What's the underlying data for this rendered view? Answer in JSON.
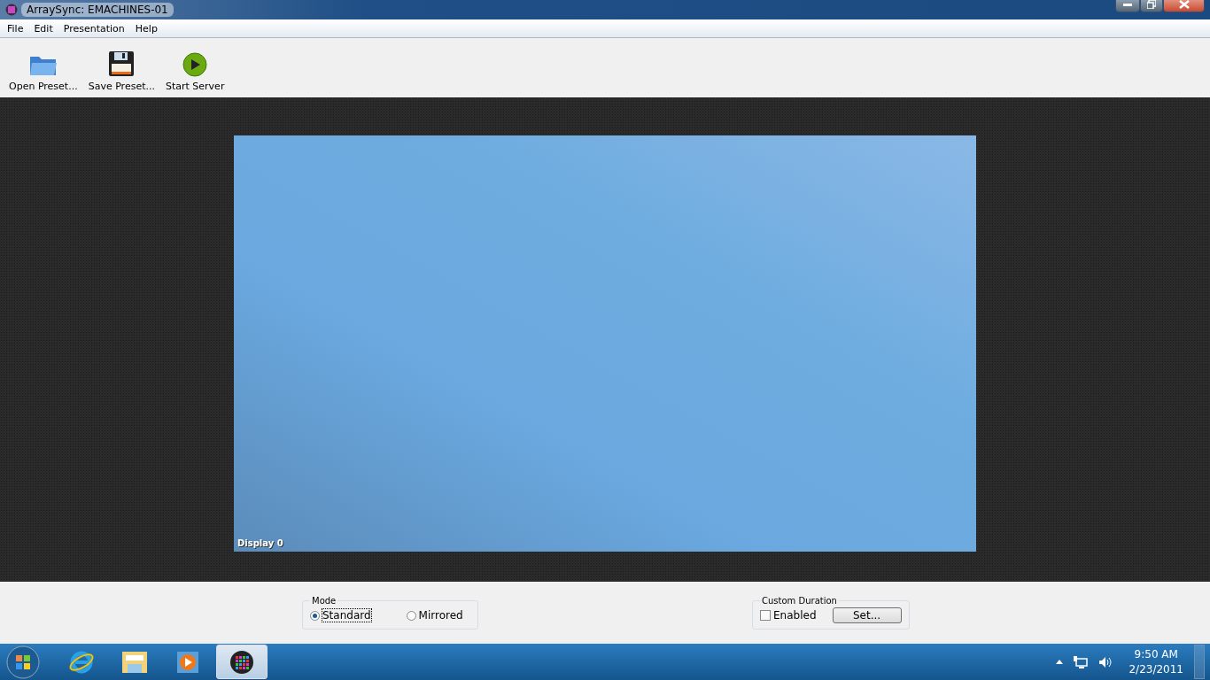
{
  "window": {
    "title": "ArraySync: EMACHINES-01"
  },
  "menu": [
    "File",
    "Edit",
    "Presentation",
    "Help"
  ],
  "toolbar": [
    {
      "kind": "open",
      "label": "Open Preset..."
    },
    {
      "kind": "save",
      "label": "Save Preset..."
    },
    {
      "kind": "start",
      "label": "Start Server"
    }
  ],
  "display": {
    "label": "Display 0"
  },
  "mode": {
    "title": "Mode",
    "options": [
      {
        "label": "Standard",
        "selected": true
      },
      {
        "label": "Mirrored",
        "selected": false
      }
    ]
  },
  "custom_duration": {
    "title": "Custom Duration",
    "enabled": {
      "label": "Enabled",
      "checked": false
    },
    "button": "Set..."
  },
  "taskbar": {
    "apps": [
      {
        "kind": "ie",
        "selected": false
      },
      {
        "kind": "folder",
        "selected": false
      },
      {
        "kind": "media",
        "selected": false
      },
      {
        "kind": "arraysync",
        "selected": true
      }
    ],
    "time": "9:50 AM",
    "date": "2/23/2011"
  }
}
